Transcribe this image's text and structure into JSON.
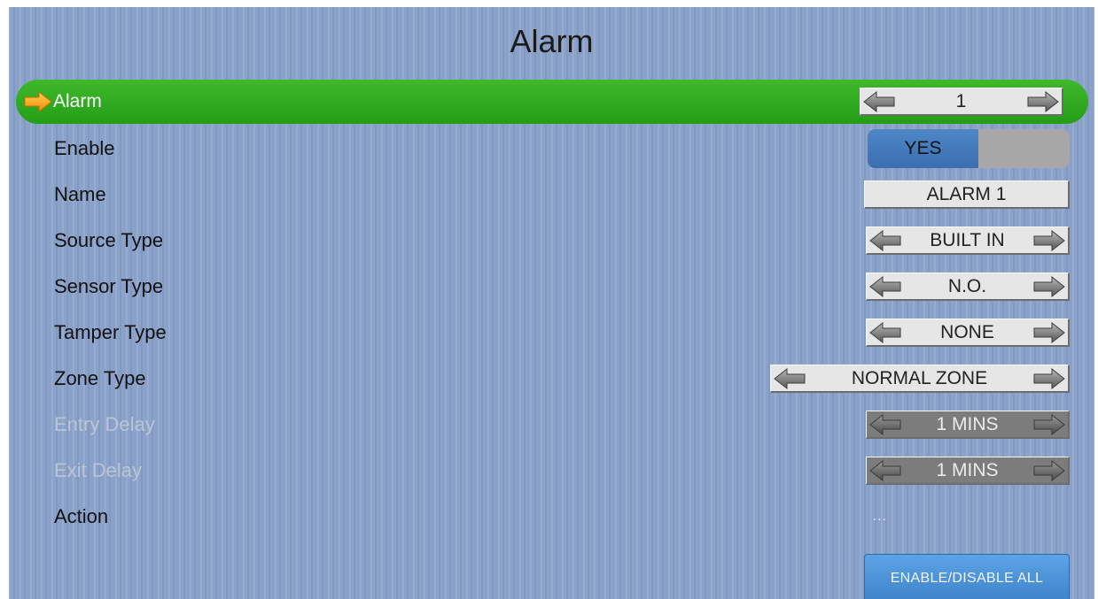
{
  "title": "Alarm",
  "rows": [
    {
      "label": "Alarm",
      "value": "1"
    },
    {
      "label": "Enable",
      "value": "YES"
    },
    {
      "label": "Name",
      "value": "ALARM 1"
    },
    {
      "label": "Source Type",
      "value": "BUILT IN"
    },
    {
      "label": "Sensor Type",
      "value": "N.O."
    },
    {
      "label": "Tamper Type",
      "value": "NONE"
    },
    {
      "label": "Zone Type",
      "value": "NORMAL ZONE"
    },
    {
      "label": "Entry Delay",
      "value": "1 MINS"
    },
    {
      "label": "Exit Delay",
      "value": "1 MINS"
    },
    {
      "label": "Action",
      "value": "..."
    }
  ],
  "enable_all_button": "ENABLE/DISABLE ALL",
  "icons": {
    "pointer": "arrow-right-icon",
    "prev": "arrow-left-icon",
    "next": "arrow-right-icon"
  },
  "colors": {
    "selected_row": "#2fae1f",
    "background": "#8aa2c9",
    "toggle_on": "#4479bb",
    "button": "#4d93d8"
  }
}
